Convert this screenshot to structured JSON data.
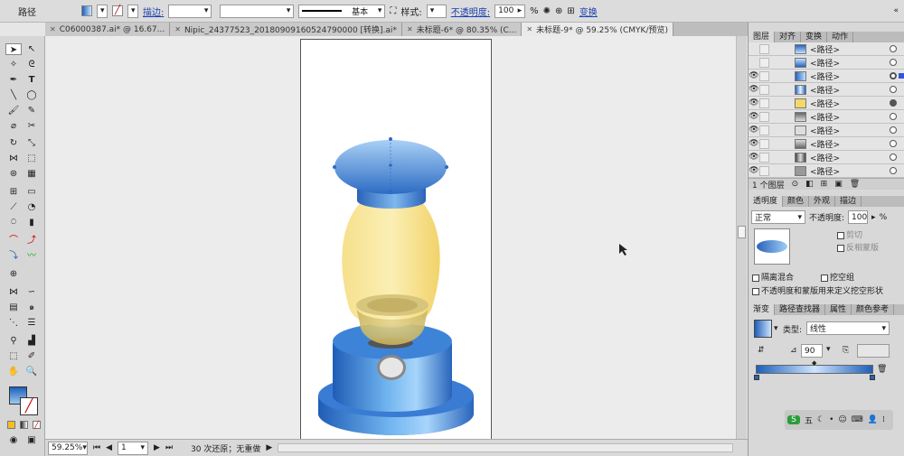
{
  "control_bar": {
    "path_label": "路径",
    "stroke_label": "描边:",
    "stroke_width": "",
    "profile_label": "基本",
    "style_label": "样式:",
    "opacity_label": "不透明度:",
    "opacity_value": "100",
    "opacity_unit": "%",
    "transform_link": "变换"
  },
  "doc_tabs": [
    {
      "label": "C06000387.ai* @ 16.67..."
    },
    {
      "label": "Nipic_24377523_20180909160524790000 [转换].ai*"
    },
    {
      "label": "未标题-6* @ 80.35% (C..."
    },
    {
      "label": "未标题-9* @ 59.25% (CMYK/预览)"
    }
  ],
  "status_bar": {
    "zoom": "59.25%",
    "page": "1",
    "history": "30 次还原；无重做"
  },
  "layers_panel": {
    "tabs": [
      "图层",
      "对齐",
      "变换",
      "动作"
    ],
    "rows": [
      {
        "name": "<路径>",
        "visible": false
      },
      {
        "name": "<路径>",
        "visible": false
      },
      {
        "name": "<路径>",
        "visible": true
      },
      {
        "name": "<路径>",
        "visible": true
      },
      {
        "name": "<路径>",
        "visible": true
      },
      {
        "name": "<路径>",
        "visible": true
      },
      {
        "name": "<路径>",
        "visible": true
      },
      {
        "name": "<路径>",
        "visible": true
      },
      {
        "name": "<路径>",
        "visible": true
      },
      {
        "name": "<路径>",
        "visible": true
      }
    ],
    "footer_label": "1 个图层"
  },
  "transparency_panel": {
    "tabs": [
      "透明度",
      "颜色",
      "外观",
      "描边"
    ],
    "blend_mode": "正常",
    "opacity_label": "不透明度:",
    "opacity_value": "100",
    "opacity_unit": "%",
    "clip_label": "剪切",
    "invert_mask_label": "反相蒙版",
    "isolate_blending_label": "隔离混合",
    "knockout_group_label": "挖空组",
    "opacity_mask_label": "不透明度和蒙版用来定义挖空形状"
  },
  "gradient_panel": {
    "tabs": [
      "渐变",
      "路径查找器",
      "属性",
      "颜色参考"
    ],
    "type_label": "类型:",
    "type_value": "线性",
    "angle_value": "90"
  },
  "taskbar": {
    "ime_label": "五"
  },
  "colors": {
    "accent": "#1a3fb0",
    "lamp_blue": "#2f7fd6",
    "glass_yellow": "#f3d96a"
  }
}
